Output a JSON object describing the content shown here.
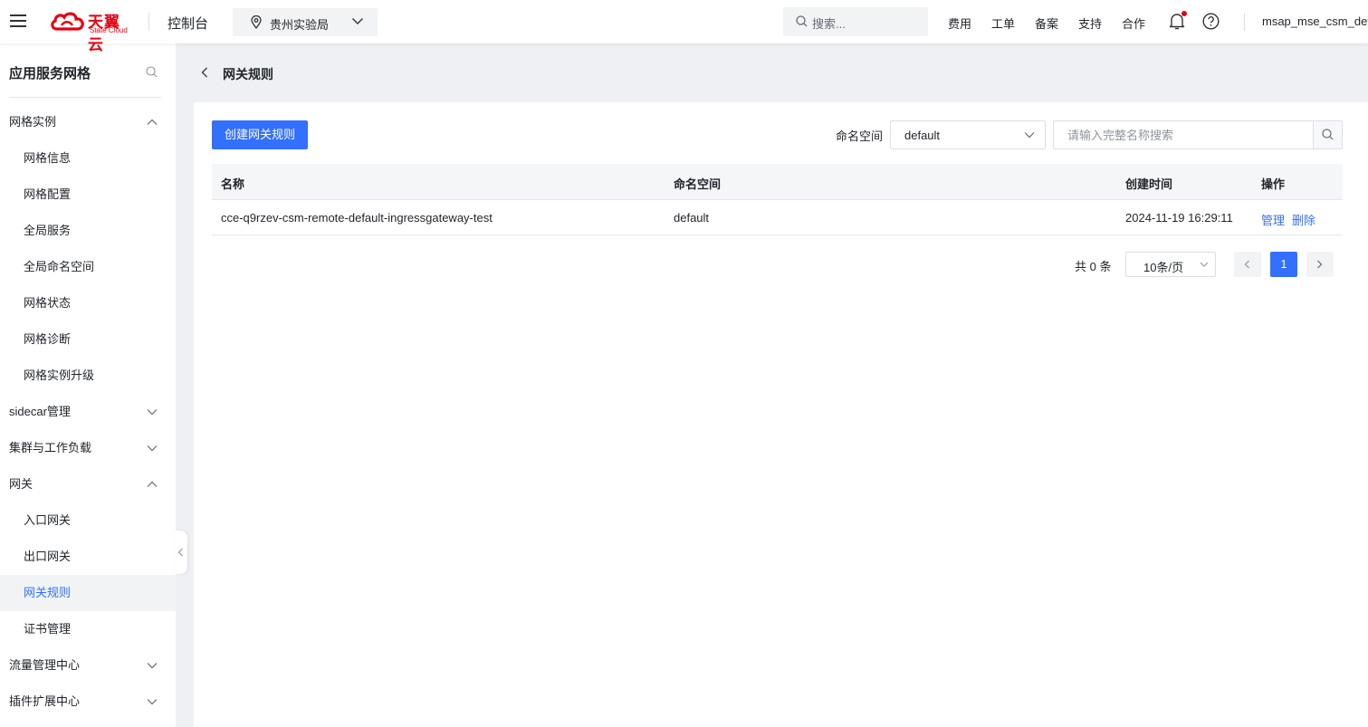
{
  "topbar": {
    "logo_cn": "天翼云",
    "logo_en": "State Cloud",
    "console": "控制台",
    "region": "贵州实验局",
    "search_placeholder": "搜索...",
    "nav": [
      "费用",
      "工单",
      "备案",
      "支持",
      "合作"
    ],
    "user": "msap_mse_csm_dev",
    "accent": "#e60012"
  },
  "sidebar": {
    "title": "应用服务网格",
    "groups": {
      "mesh_instance": "网格实例",
      "sidecar": "sidecar管理",
      "cluster": "集群与工作负载",
      "gateway": "网关",
      "traffic": "流量管理中心",
      "plugin": "插件扩展中心"
    },
    "mesh_items": [
      "网格信息",
      "网格配置",
      "全局服务",
      "全局命名空间",
      "网格状态",
      "网格诊断",
      "网格实例升级"
    ],
    "gateway_items": [
      "入口网关",
      "出口网关",
      "网关规则",
      "证书管理"
    ],
    "active_item": "网关规则"
  },
  "page": {
    "title": "网关规则",
    "create_button": "创建网关规则",
    "namespace_label": "命名空间",
    "namespace_value": "default",
    "search_placeholder": "请输入完整名称搜索"
  },
  "table": {
    "headers": {
      "name": "名称",
      "namespace": "命名空间",
      "created": "创建时间",
      "actions": "操作"
    },
    "rows": [
      {
        "name": "cce-q9rzev-csm-remote-default-ingressgateway-test",
        "namespace": "default",
        "created": "2024-11-19 16:29:11",
        "manage": "管理",
        "delete": "删除"
      }
    ]
  },
  "pagination": {
    "total": "共 0 条",
    "page_size": "10条/页",
    "current_page": "1"
  },
  "colors": {
    "primary": "#3370ff",
    "brand_red": "#e60012"
  }
}
